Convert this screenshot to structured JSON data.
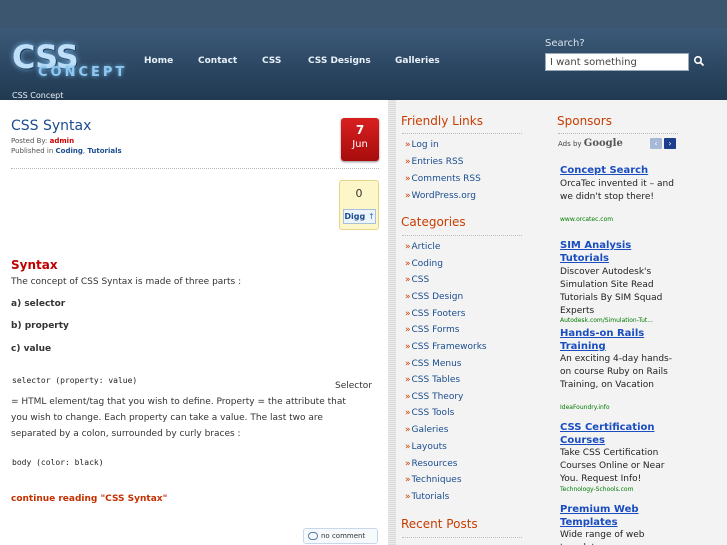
{
  "header": {
    "logo_big": "CSS",
    "logo_small": "CONCEPT",
    "tagline": "CSS Concept",
    "nav": [
      "Home",
      "Contact",
      "CSS",
      "CSS Designs",
      "Galleries"
    ],
    "search_label": "Search?",
    "search_value": "I want something"
  },
  "post": {
    "title": "CSS Syntax",
    "posted_by_label": "Posted By: ",
    "author": "admin",
    "published_label": "Published in ",
    "cat1": "Coding",
    "cat2": "Tutorials",
    "date_day": "7",
    "date_month": "Jun",
    "digg_count": "0",
    "digg_label": "Digg",
    "section_heading": "Syntax",
    "intro": "The concept of CSS Syntax is made of three parts :",
    "parts": [
      "a) selector",
      "b) property",
      "c) value"
    ],
    "code1": "selector (property: value)",
    "selector_label": "Selector",
    "para_line1": "= HTML element/tag that you wish to define. Property = the attribute that",
    "para_line2": "you wish to change. Each property can take a value. The last two are",
    "para_line3": "separated by a colon, surrounded by curly braces :",
    "code2": "body (color: black)",
    "continue_label": "continue reading \"CSS Syntax\"",
    "comment_label": "no comment"
  },
  "sidebar": {
    "friendly_heading": "Friendly Links",
    "friendly_links": [
      "Log in",
      "Entries RSS",
      "Comments RSS",
      "WordPress.org"
    ],
    "categories_heading": "Categories",
    "categories": [
      "Article",
      "Coding",
      "CSS",
      "CSS Design",
      "CSS Footers",
      "CSS Forms",
      "CSS Frameworks",
      "CSS Menus",
      "CSS Tables",
      "CSS Theory",
      "CSS Tools",
      "Galeries",
      "Layouts",
      "Resources",
      "Techniques",
      "Tutorials"
    ],
    "recent_heading": "Recent Posts"
  },
  "sponsors": {
    "heading": "Sponsors",
    "ads_by": "Ads by ",
    "google": "Google",
    "ads": [
      {
        "title": "Concept Search",
        "text": "OrcaTec invented it – and we didn't stop there!",
        "url": "www.orcatec.com"
      },
      {
        "title": "SIM Analysis Tutorials",
        "text": "Discover Autodesk's Simulation Site Read Tutorials By SIM Squad Experts",
        "url": "Autodesk.com/Simulation-Tut..."
      },
      {
        "title": "Hands-on Rails Training",
        "text": "An exciting 4-day hands-on course Ruby on Rails Training, on Vacation",
        "url": "IdeaFoundry.info"
      },
      {
        "title": "CSS Certification Courses",
        "text": "Take CSS Certification Courses Online or Near You. Request Info!",
        "url": "Technology-Schools.com"
      },
      {
        "title": "Premium Web Templates",
        "text": "Wide range of web templates",
        "url": ""
      }
    ]
  },
  "colors": {
    "accent": "#c83c00",
    "link": "#1a4d8f",
    "header": "#2a4560",
    "date_badge": "#c81818"
  }
}
